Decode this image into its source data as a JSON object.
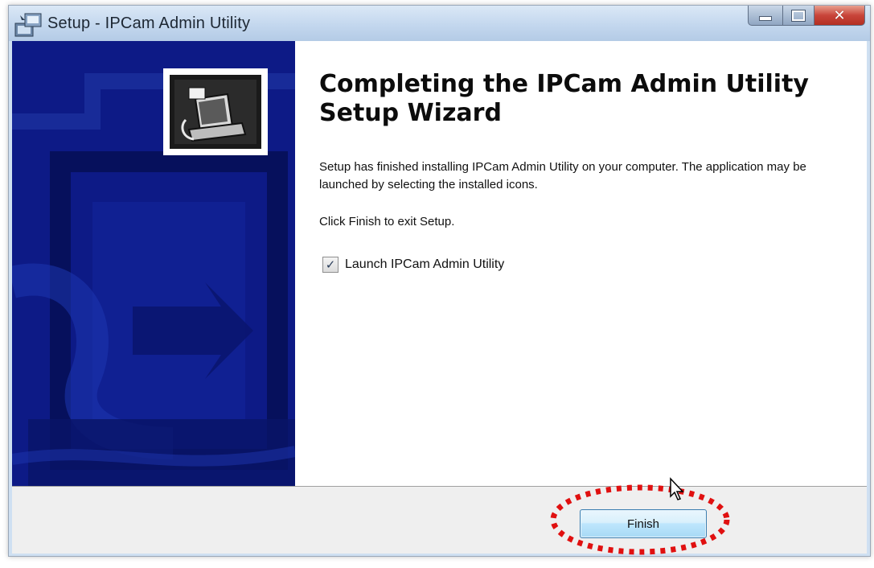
{
  "window": {
    "title": "Setup - IPCam Admin Utility",
    "close_glyph": "✕"
  },
  "wizard": {
    "heading": "Completing the IPCam Admin Utility Setup Wizard",
    "paragraph_1": "Setup has finished installing IPCam Admin Utility on your computer. The application may be launched by selecting the installed icons.",
    "paragraph_2": "Click Finish to exit Setup.",
    "launch_checkbox": {
      "label": "Launch IPCam Admin Utility",
      "checked": true,
      "check_glyph": "✓"
    }
  },
  "footer": {
    "finish_label": "Finish"
  },
  "colors": {
    "side_panel": "#0d1a86",
    "highlight": "#e01010"
  },
  "icons": {
    "window_icon": "setup-computer-icon",
    "wizard_image": "computer-install-icon",
    "cursor": "mouse-pointer-icon"
  }
}
